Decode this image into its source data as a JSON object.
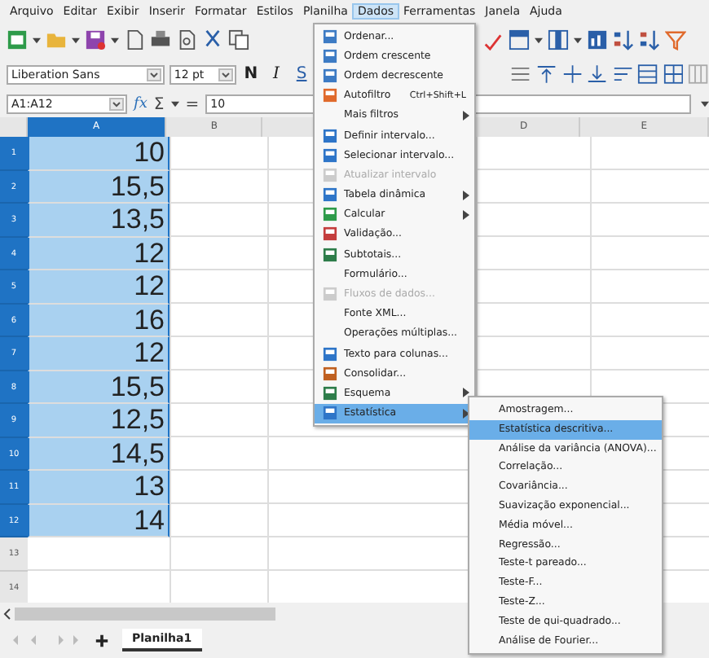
{
  "menu_bar": [
    {
      "label": "Arquivo",
      "selected": false
    },
    {
      "label": "Editar",
      "selected": false
    },
    {
      "label": "Exibir",
      "selected": false
    },
    {
      "label": "Inserir",
      "selected": false
    },
    {
      "label": "Formatar",
      "selected": false
    },
    {
      "label": "Estilos",
      "selected": false
    },
    {
      "label": "Planilha",
      "selected": false
    },
    {
      "label": "Dados",
      "selected": true
    },
    {
      "label": "Ferramentas",
      "selected": false
    },
    {
      "label": "Janela",
      "selected": false
    },
    {
      "label": "Ajuda",
      "selected": false
    }
  ],
  "formatting": {
    "font": "Liberation Sans",
    "size": "12 pt",
    "bold": "N",
    "italic": "I",
    "underline": "S"
  },
  "formula_bar": {
    "name_box": "A1:A12",
    "function_wizard": "fx",
    "sum": "Σ",
    "equals": "=",
    "value": "10"
  },
  "columns": [
    {
      "label": "A",
      "selected": true
    },
    {
      "label": "B",
      "selected": false
    },
    {
      "label": "D",
      "selected": false
    },
    {
      "label": "E",
      "selected": false
    }
  ],
  "rows": [
    {
      "number": "1",
      "value": "10",
      "selected": true
    },
    {
      "number": "2",
      "value": "15,5",
      "selected": true
    },
    {
      "number": "3",
      "value": "13,5",
      "selected": true
    },
    {
      "number": "4",
      "value": "12",
      "selected": true
    },
    {
      "number": "5",
      "value": "12",
      "selected": true
    },
    {
      "number": "6",
      "value": "16",
      "selected": true
    },
    {
      "number": "7",
      "value": "12",
      "selected": true
    },
    {
      "number": "8",
      "value": "15,5",
      "selected": true
    },
    {
      "number": "9",
      "value": "12,5",
      "selected": true
    },
    {
      "number": "10",
      "value": "14,5",
      "selected": true
    },
    {
      "number": "11",
      "value": "13",
      "selected": true
    },
    {
      "number": "12",
      "value": "14",
      "selected": true
    },
    {
      "number": "13",
      "value": "",
      "selected": false
    },
    {
      "number": "14",
      "value": "",
      "selected": false
    }
  ],
  "dados_menu": [
    {
      "label": "Ordenar...",
      "icon": true,
      "disabled": false,
      "submenu": false,
      "selected": false
    },
    {
      "label": "Ordem crescente",
      "icon": true,
      "disabled": false,
      "submenu": false,
      "selected": false
    },
    {
      "label": "Ordem decrescente",
      "icon": true,
      "disabled": false,
      "submenu": false,
      "selected": false
    },
    {
      "label": "Autofiltro",
      "shortcut": "Ctrl+Shift+L",
      "icon": true,
      "disabled": false,
      "submenu": false,
      "selected": false
    },
    {
      "label": "Mais filtros",
      "icon": false,
      "disabled": false,
      "submenu": true,
      "selected": false
    },
    {
      "label": "Definir intervalo...",
      "icon": true,
      "disabled": false,
      "submenu": false,
      "selected": false
    },
    {
      "label": "Selecionar intervalo...",
      "icon": true,
      "disabled": false,
      "submenu": false,
      "selected": false
    },
    {
      "label": "Atualizar intervalo",
      "icon": true,
      "disabled": true,
      "submenu": false,
      "selected": false
    },
    {
      "label": "Tabela dinâmica",
      "icon": true,
      "disabled": false,
      "submenu": true,
      "selected": false
    },
    {
      "label": "Calcular",
      "icon": true,
      "disabled": false,
      "submenu": true,
      "selected": false
    },
    {
      "label": "Validação...",
      "icon": true,
      "disabled": false,
      "submenu": false,
      "selected": false
    },
    {
      "label": "Subtotais...",
      "icon": true,
      "disabled": false,
      "submenu": false,
      "selected": false
    },
    {
      "label": "Formulário...",
      "icon": false,
      "disabled": false,
      "submenu": false,
      "selected": false
    },
    {
      "label": "Fluxos de dados...",
      "icon": true,
      "disabled": true,
      "submenu": false,
      "selected": false
    },
    {
      "label": "Fonte XML...",
      "icon": false,
      "disabled": false,
      "submenu": false,
      "selected": false
    },
    {
      "label": "Operações múltiplas...",
      "icon": false,
      "disabled": false,
      "submenu": false,
      "selected": false
    },
    {
      "label": "Texto para colunas...",
      "icon": true,
      "disabled": false,
      "submenu": false,
      "selected": false
    },
    {
      "label": "Consolidar...",
      "icon": true,
      "disabled": false,
      "submenu": false,
      "selected": false
    },
    {
      "label": "Esquema",
      "icon": true,
      "disabled": false,
      "submenu": true,
      "selected": false
    },
    {
      "label": "Estatística",
      "icon": true,
      "disabled": false,
      "submenu": true,
      "selected": true
    }
  ],
  "statistics_submenu": [
    {
      "label": "Amostragem...",
      "selected": false
    },
    {
      "label": "Estatística descritiva...",
      "selected": true
    },
    {
      "label": "Análise da variância (ANOVA)...",
      "selected": false
    },
    {
      "label": "Correlação...",
      "selected": false
    },
    {
      "label": "Covariância...",
      "selected": false
    },
    {
      "label": "Suavização exponencial...",
      "selected": false
    },
    {
      "label": "Média móvel...",
      "selected": false
    },
    {
      "label": "Regressão...",
      "selected": false
    },
    {
      "label": "Teste-t pareado...",
      "selected": false
    },
    {
      "label": "Teste-F...",
      "selected": false
    },
    {
      "label": "Teste-Z...",
      "selected": false
    },
    {
      "label": "Teste de qui-quadrado...",
      "selected": false
    },
    {
      "label": "Análise de Fourier...",
      "selected": false
    }
  ],
  "sheet_tabs": [
    {
      "label": "Planilha1",
      "selected": true
    }
  ]
}
